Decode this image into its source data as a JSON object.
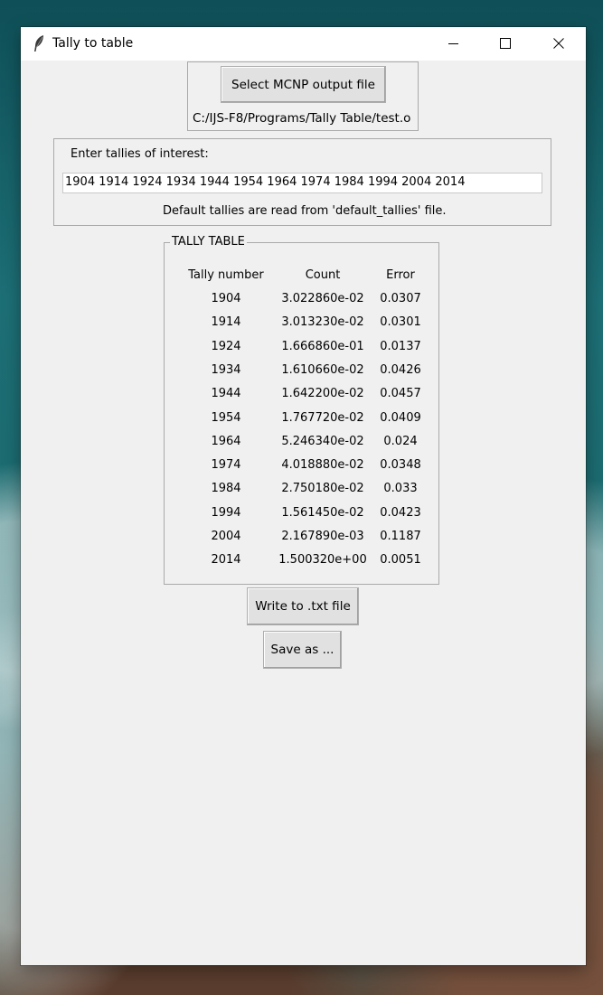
{
  "window": {
    "title": "Tally to table"
  },
  "file_section": {
    "select_button_label": "Select MCNP output file",
    "file_path": "C:/IJS-F8/Programs/Tally Table/test.o"
  },
  "tallies_section": {
    "prompt": "Enter tallies of interest:",
    "input_value": "1904 1914 1924 1934 1944 1954 1964 1974 1984 1994 2004 2014",
    "note": "Default tallies are read from 'default_tallies' file."
  },
  "table": {
    "title": "TALLY TABLE",
    "headers": [
      "Tally number",
      "Count",
      "Error"
    ],
    "rows": [
      [
        "1904",
        "3.022860e-02",
        "0.0307"
      ],
      [
        "1914",
        "3.013230e-02",
        "0.0301"
      ],
      [
        "1924",
        "1.666860e-01",
        "0.0137"
      ],
      [
        "1934",
        "1.610660e-02",
        "0.0426"
      ],
      [
        "1944",
        "1.642200e-02",
        "0.0457"
      ],
      [
        "1954",
        "1.767720e-02",
        "0.0409"
      ],
      [
        "1964",
        "5.246340e-02",
        "0.024"
      ],
      [
        "1974",
        "4.018880e-02",
        "0.0348"
      ],
      [
        "1984",
        "2.750180e-02",
        "0.033"
      ],
      [
        "1994",
        "1.561450e-02",
        "0.0423"
      ],
      [
        "2004",
        "2.167890e-03",
        "0.1187"
      ],
      [
        "2014",
        "1.500320e+00",
        "0.0051"
      ]
    ]
  },
  "actions": {
    "write_button_label": "Write to .txt file",
    "save_as_button_label": "Save as ..."
  },
  "icons": {
    "app": "feather-icon",
    "minimize": "minimize-icon",
    "maximize": "maximize-icon",
    "close": "close-icon"
  }
}
